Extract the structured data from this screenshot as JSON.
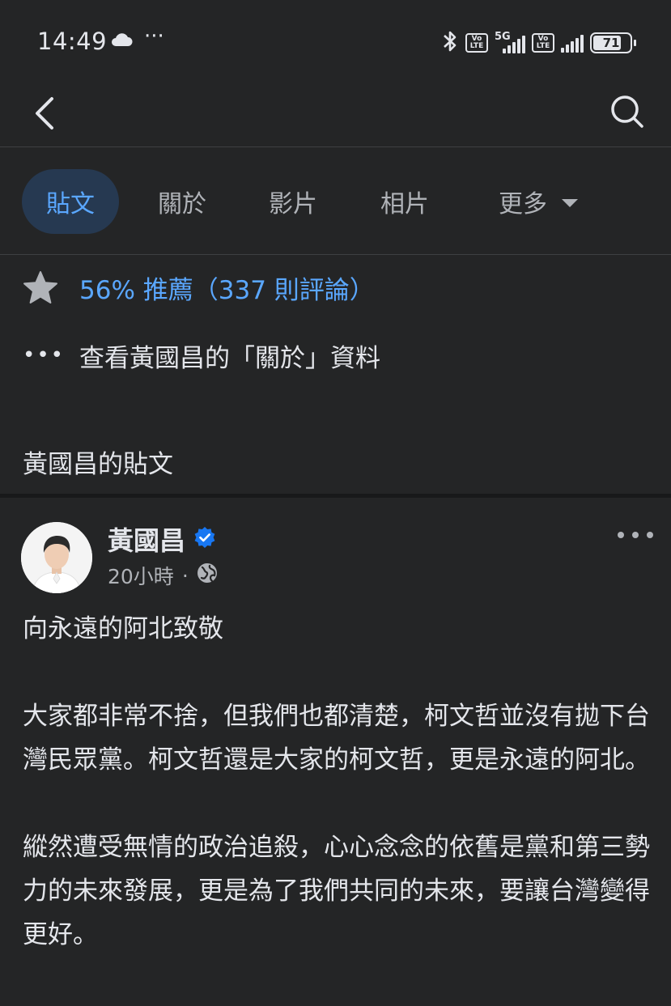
{
  "status_bar": {
    "time": "14:49",
    "dots": "···",
    "net_label": "5G",
    "volte_label": "Vo LTE",
    "battery": "71"
  },
  "tabs": [
    {
      "label": "貼文",
      "active": true
    },
    {
      "label": "關於"
    },
    {
      "label": "影片"
    },
    {
      "label": "相片"
    },
    {
      "label": "更多"
    }
  ],
  "recommend": "56% 推薦（337 則評論）",
  "about_link": "查看黃國昌的「關於」資料",
  "posts_heading": "黃國昌的貼文",
  "post": {
    "author": "黃國昌",
    "time": "20小時",
    "separator": "·",
    "paragraphs": [
      "向永遠的阿北致敬",
      "大家都非常不捨，但我們也都清楚，柯文哲並沒有拋下台灣民眾黨。柯文哲還是大家的柯文哲，更是永遠的阿北。",
      "縱然遭受無情的政治追殺，心心念念的依舊是黨和第三勢力的未來發展，更是為了我們共同的未來，要讓台灣變得更好。"
    ]
  },
  "colors": {
    "background": "#242526",
    "accent": "#5aa7ff",
    "active_tab_bg": "#263951",
    "verified": "#1877f2"
  },
  "icons": [
    "back-arrow-icon",
    "search-icon",
    "star-icon",
    "ellipsis-icon",
    "verified-badge-icon",
    "globe-icon",
    "more-options-icon",
    "cloud-icon",
    "bluetooth-icon"
  ]
}
